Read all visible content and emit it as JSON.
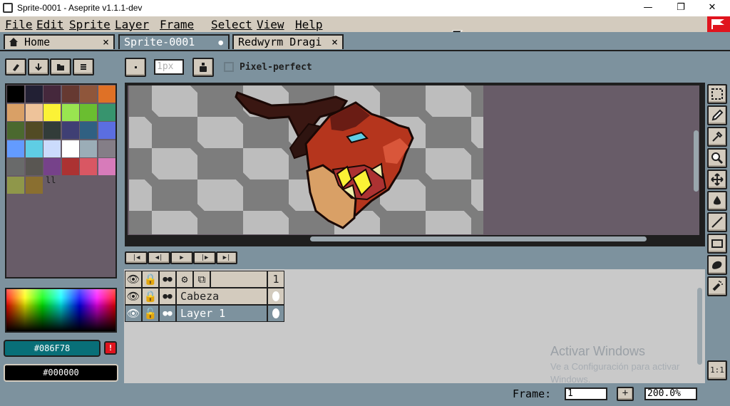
{
  "window": {
    "title": "Sprite-0001 - Aseprite v1.1.1-dev",
    "minimize": "—",
    "maximize": "❐",
    "close": "✕"
  },
  "menu": [
    "File",
    "Edit",
    "Sprite",
    "Layer",
    "Frame",
    "Select",
    "View",
    "Help"
  ],
  "tabs": [
    {
      "label": "Home",
      "close": "×"
    },
    {
      "label": "Sprite-0001",
      "close": "●"
    },
    {
      "label": "Redwyrm Dragi",
      "close": "×"
    }
  ],
  "context_bar": {
    "brush_size": "1px",
    "pixel_perfect_label": "Pixel-perfect"
  },
  "palette": {
    "colors": [
      "#000000",
      "#222034",
      "#45283c",
      "#663931",
      "#8f563b",
      "#df7126",
      "#d9a066",
      "#eec39a",
      "#fbf236",
      "#99e550",
      "#6abe30",
      "#37946e",
      "#4b692f",
      "#524b24",
      "#323c39",
      "#3f3f74",
      "#306082",
      "#5b6ee1",
      "#639bff",
      "#5fcde4",
      "#cbdbfc",
      "#ffffff",
      "#9badb7",
      "#847e87",
      "#696a6a",
      "#595652",
      "#76428a",
      "#ac3232",
      "#d95763",
      "#d77bba",
      "#8f974a",
      "#8a6f30"
    ],
    "more_indicator": "ll"
  },
  "colors": {
    "foreground": "#086F78",
    "background": "#000000",
    "warning": "!"
  },
  "timeline": {
    "header_frame": "1",
    "layers": [
      {
        "name": "Cabeza",
        "selected": false
      },
      {
        "name": "Layer 1",
        "selected": true
      }
    ]
  },
  "watermark": {
    "line1": "Activar Windows",
    "line2": "Ve a Configuración para activar",
    "line3": "Windows."
  },
  "statusbar": {
    "frame_label": "Frame:",
    "frame_value": "1",
    "add_frame": "+",
    "zoom": "200.0%"
  },
  "tools": [
    "marquee-icon",
    "pencil-icon",
    "eyedropper-icon",
    "zoom-icon",
    "move-icon",
    "paint-bucket-icon",
    "line-icon",
    "rectangle-icon",
    "blob-icon",
    "spray-icon"
  ],
  "ratio_button": "1:1"
}
